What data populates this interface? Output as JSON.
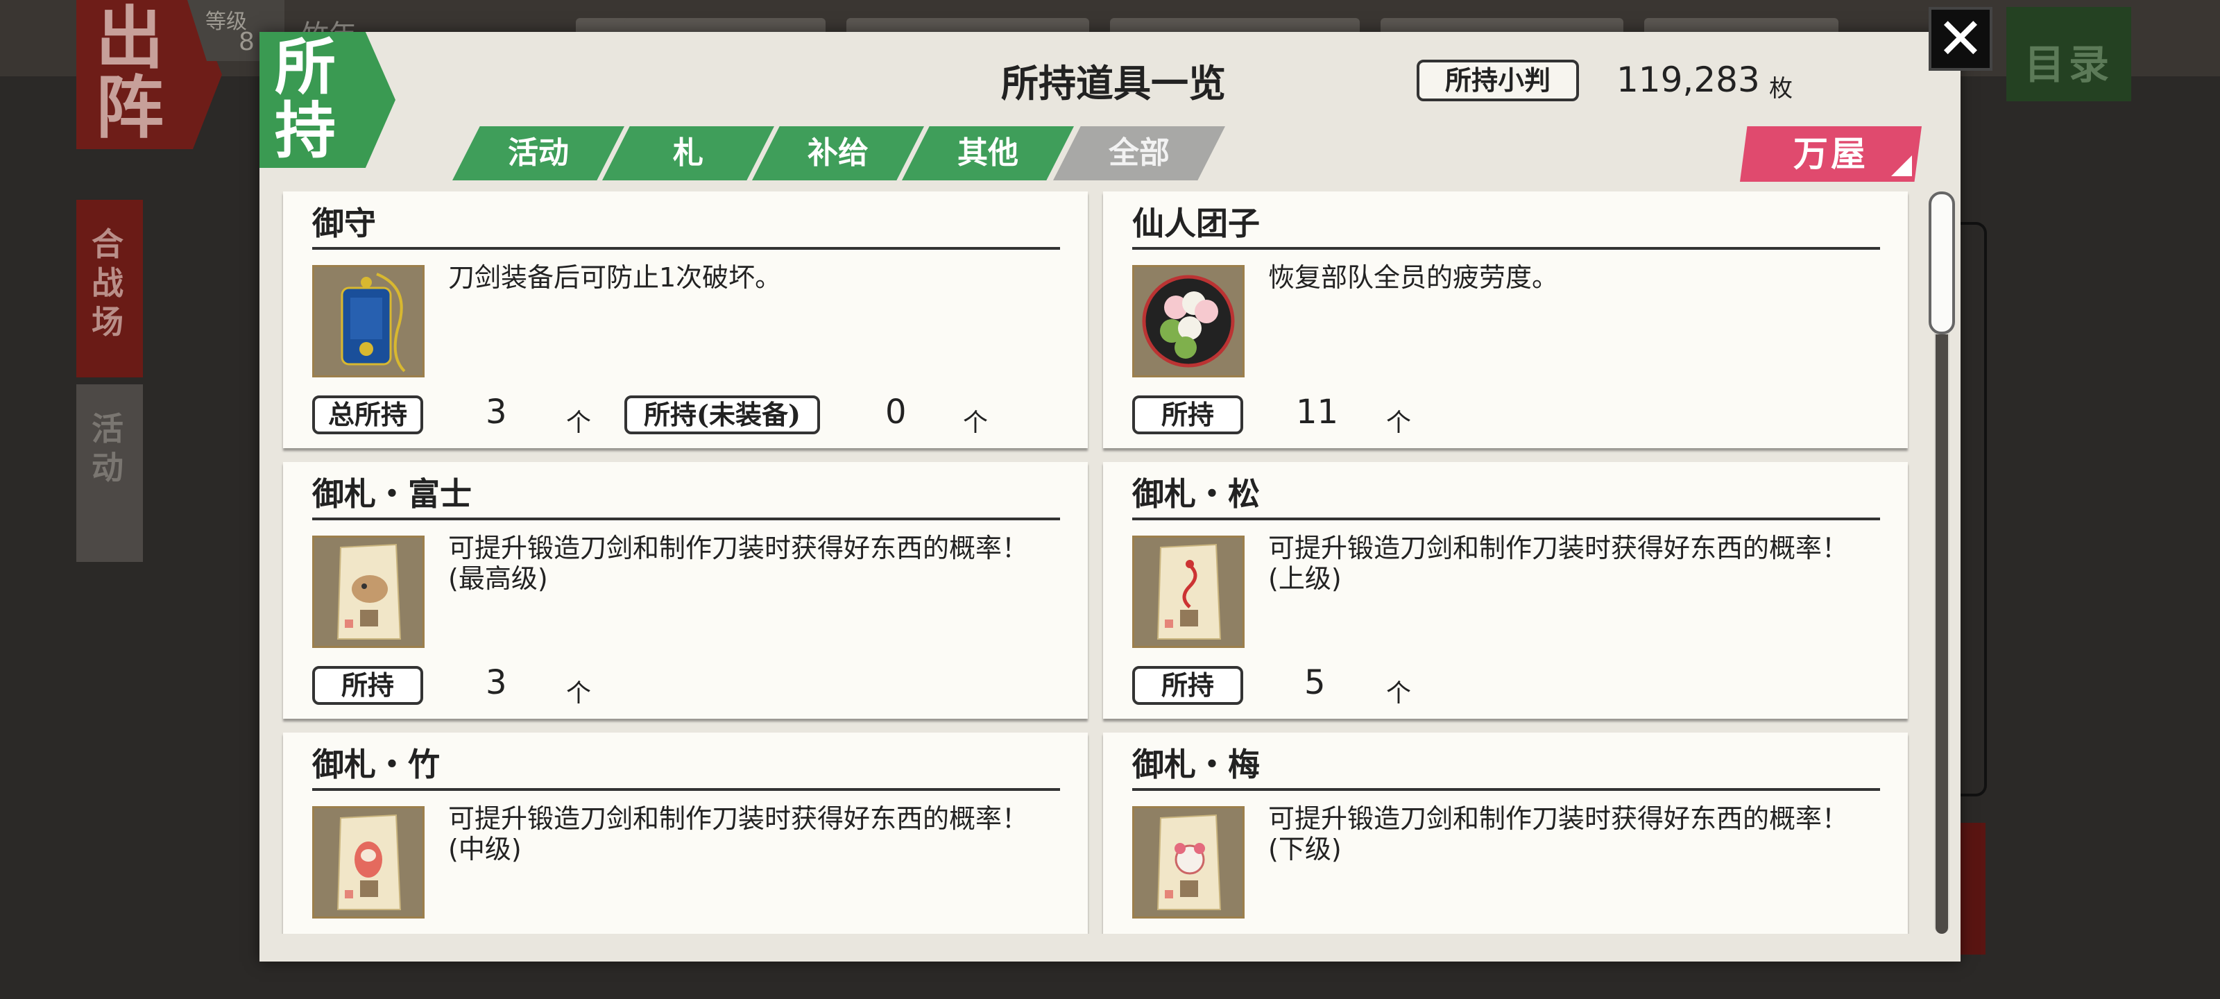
{
  "background": {
    "sortie_label": "出阵",
    "level_label": "等级",
    "level_value": "8",
    "player_name": "竹年",
    "side_tabs": [
      "合战场",
      "活动"
    ],
    "menu_label": "目录"
  },
  "dialog": {
    "corner_tag": "所持",
    "title": "所持道具一览",
    "koban_label": "所持小判",
    "koban_value": "119,283",
    "koban_unit": "枚",
    "close_symbol": "✕",
    "tabs": [
      {
        "label": "活动",
        "active": false
      },
      {
        "label": "札",
        "active": false
      },
      {
        "label": "补给",
        "active": false
      },
      {
        "label": "其他",
        "active": false
      },
      {
        "label": "全部",
        "active": true
      }
    ],
    "shop_button": "万屋"
  },
  "items": [
    {
      "name": "御守",
      "icon": "omamori-icon",
      "description": "刀剑装备后可防止1次破坏。",
      "counts": [
        {
          "label": "总所持",
          "value": "3",
          "unit": "个"
        },
        {
          "label": "所持(未装备)",
          "value": "0",
          "unit": "个"
        }
      ]
    },
    {
      "name": "仙人团子",
      "icon": "dango-icon",
      "description": "恢复部队全员的疲劳度。",
      "counts": [
        {
          "label": "所持",
          "value": "11",
          "unit": "个"
        }
      ]
    },
    {
      "name": "御札・富士",
      "icon": "fuda-fuji-icon",
      "description": "可提升锻造刀剑和制作刀装时获得好东西的概率！(最高级)",
      "counts": [
        {
          "label": "所持",
          "value": "3",
          "unit": "个"
        }
      ]
    },
    {
      "name": "御札・松",
      "icon": "fuda-matsu-icon",
      "description": "可提升锻造刀剑和制作刀装时获得好东西的概率！(上级)",
      "counts": [
        {
          "label": "所持",
          "value": "5",
          "unit": "个"
        }
      ]
    },
    {
      "name": "御札・竹",
      "icon": "fuda-take-icon",
      "description": "可提升锻造刀剑和制作刀装时获得好东西的概率！(中级)",
      "counts": []
    },
    {
      "name": "御札・梅",
      "icon": "fuda-ume-icon",
      "description": "可提升锻造刀剑和制作刀装时获得好东西的概率！(下级)",
      "counts": []
    }
  ],
  "colors": {
    "tab_green": "#3f9e5a",
    "tab_inactive": "#a8a8a6",
    "shop_pink": "#e04a6e",
    "card_bg": "#fcfbf6"
  }
}
